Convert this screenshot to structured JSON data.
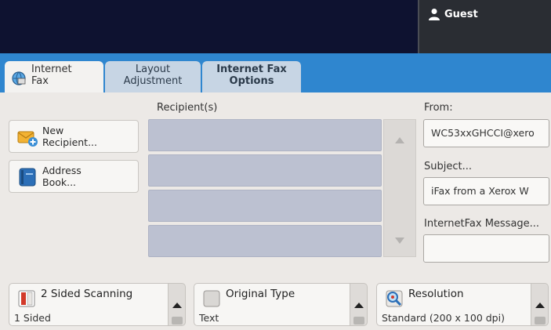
{
  "header": {
    "user_label": "Guest",
    "user_icon": "user-icon"
  },
  "tabs": [
    {
      "line1": "Internet",
      "line2": "Fax",
      "icon": "internet-fax-icon",
      "active": true
    },
    {
      "line1": "Layout",
      "line2": "Adjustment",
      "active": false
    },
    {
      "line1": "Internet Fax",
      "line2": "Options",
      "active": false
    }
  ],
  "recipients": {
    "heading": "Recipient(s)",
    "rows": [
      "",
      "",
      "",
      ""
    ]
  },
  "buttons": {
    "new_recipient": {
      "line1": "New",
      "line2": "Recipient...",
      "icon": "new-recipient-icon"
    },
    "address_book": {
      "line1": "Address",
      "line2": "Book...",
      "icon": "address-book-icon"
    }
  },
  "right": {
    "from_label": "From:",
    "from_value": "WC53xxGHCCI@xero",
    "subject_label": "Subject...",
    "subject_value": "iFax from a Xerox W",
    "message_label": "InternetFax Message...",
    "message_value": ""
  },
  "features": [
    {
      "name": "2 Sided Scanning",
      "value": "1 Sided",
      "icon": "two-sided-scanning-icon"
    },
    {
      "name": "Original Type",
      "value": "Text",
      "icon": "original-type-icon"
    },
    {
      "name": "Resolution",
      "value": "Standard (200 x 100 dpi)",
      "icon": "resolution-icon"
    }
  ],
  "colors": {
    "topbar": "#0e1230",
    "tab_strip": "#2f86cf",
    "recipient_row": "#bcc1d1"
  }
}
